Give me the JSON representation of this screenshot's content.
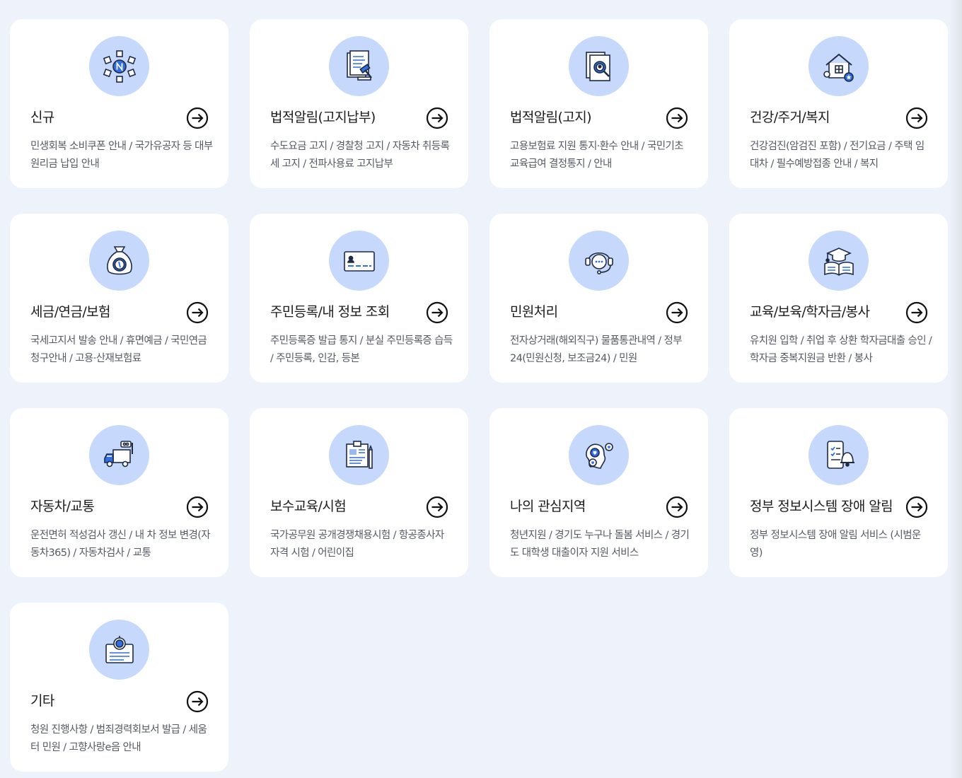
{
  "colors": {
    "page_background": "#eef3fb",
    "card_background": "#ffffff",
    "icon_circle": "#c6d8fb",
    "icon_accent": "#2f6fe0",
    "title_text": "#1b1b1b",
    "desc_text": "#555a63"
  },
  "categories": [
    {
      "title": "신규",
      "description": "민생회복 소비쿠폰 안내 / 국가유공자 등 대부원리금 납입 안내",
      "icon": "new-badge-icon"
    },
    {
      "title": "법적알림(고지납부)",
      "description": "수도요금 고지 / 경찰청 고지 / 자동차 취등록세 고지 / 전파사용료 고지납부",
      "icon": "gavel-document-icon"
    },
    {
      "title": "법적알림(고지)",
      "description": "고용보험료 지원 통지·환수 안내 / 국민기초 교육급여 결정통지 / 안내",
      "icon": "document-search-icon"
    },
    {
      "title": "건강/주거/복지",
      "description": "건강검진(암검진 포함) / 전기요금 / 주택 임대차 / 필수예방접종 안내 / 복지",
      "icon": "house-welfare-icon"
    },
    {
      "title": "세금/연금/보험",
      "description": "국세고지서 발송 안내 / 휴면예금 / 국민연금 청구안내 / 고용·산재보험료",
      "icon": "money-bag-icon"
    },
    {
      "title": "주민등록/내 정보 조회",
      "description": "주민등록증 발급 통지 / 분실 주민등록증 습득 / 주민등록, 인감, 등본",
      "icon": "id-card-icon"
    },
    {
      "title": "민원처리",
      "description": "전자상거래(해외직구) 물품통관내역 / 정부24(민원신청, 보조금24) / 민원",
      "icon": "headset-chat-icon"
    },
    {
      "title": "교육/보육/학자금/봉사",
      "description": "유치원 입학 / 취업 후 상환 학자금대출 승인 / 학자금 중복지원금 반환 / 봉사",
      "icon": "graduation-book-icon"
    },
    {
      "title": "자동차/교통",
      "description": "운전면허 적성검사 갱신 / 내 차 정보 변경(자동차365) / 자동차검사 / 교통",
      "icon": "truck-icon"
    },
    {
      "title": "보수교육/시험",
      "description": "국가공무원 공개경쟁채용시험 / 항공종사자 자격 시험 / 어린이집",
      "icon": "exam-board-icon"
    },
    {
      "title": "나의 관심지역",
      "description": "청년지원 / 경기도 누구나 돌봄 서비스 / 경기도 대학생 대출이자 지원 서비스",
      "icon": "map-heart-icon"
    },
    {
      "title": "정부 정보시스템 장애 알림",
      "description": "정부 정보시스템 장애 알림 서비스 (시범운영)",
      "icon": "phone-bell-icon"
    },
    {
      "title": "기타",
      "description": "청원 진행사항 / 범죄경력회보서 발급 / 세움터 민원 / 고향사랑e음 안내",
      "icon": "certificate-icon"
    }
  ]
}
